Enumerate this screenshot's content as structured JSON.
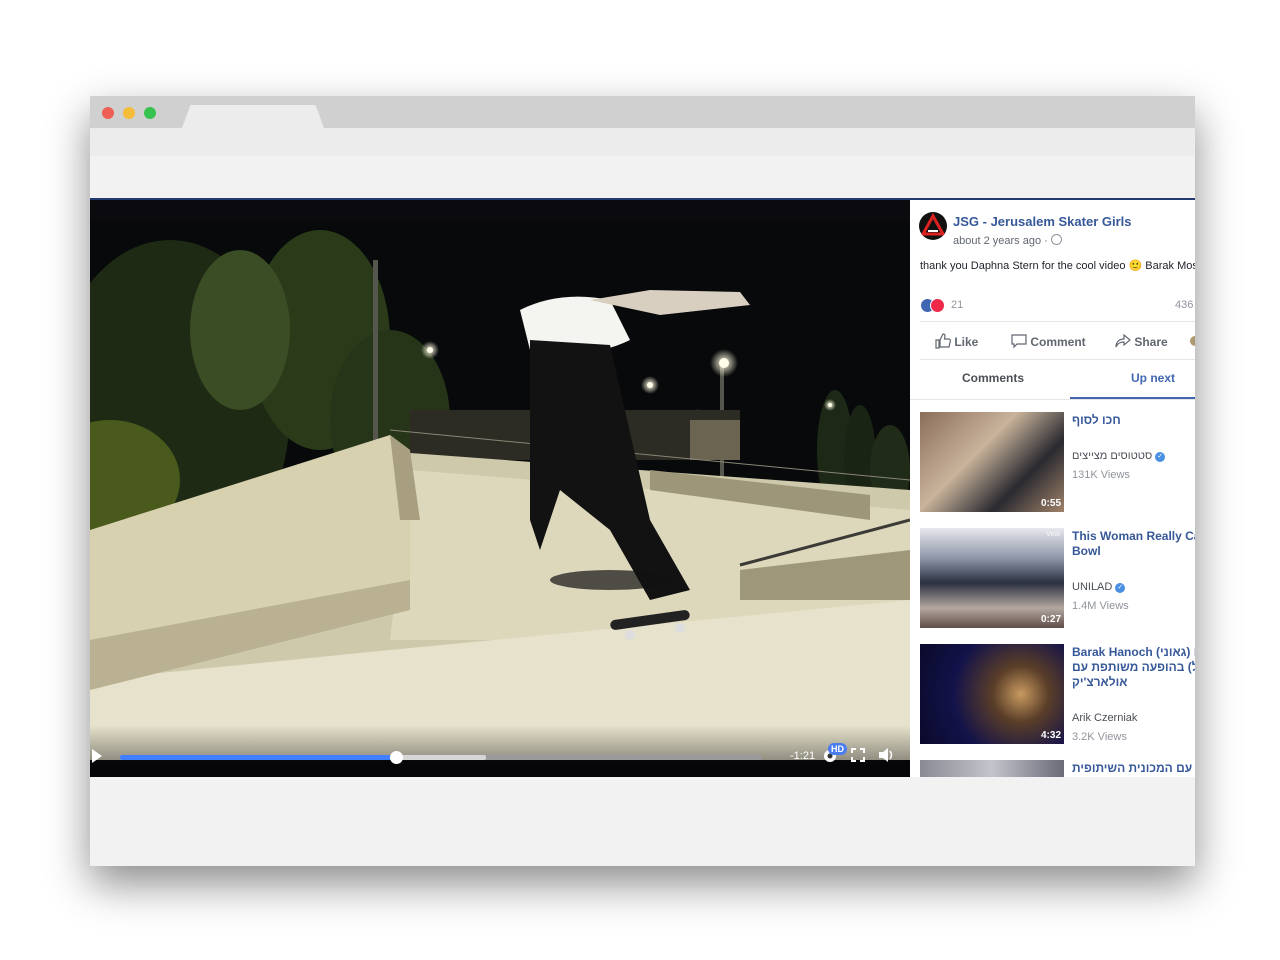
{
  "post": {
    "page_name": "JSG - Jerusalem Skater Girls",
    "time": "about 2 years ago · ",
    "text": "thank you Daphna Stern for the cool video 🙂 Barak Moses",
    "reactions_count": "21",
    "views_count": "436"
  },
  "actions": {
    "like": "Like",
    "comment": "Comment",
    "share": "Share"
  },
  "tabs": {
    "comments": "Comments",
    "up_next": "Up next"
  },
  "player": {
    "time_remaining": "-1:21",
    "hd_label": "HD",
    "progress_played": 0.43,
    "progress_buffered": 0.57
  },
  "up_next": [
    {
      "title_lines": [
        "חכו לסוף"
      ],
      "channel": "סטטוסים מצייצים",
      "views": "131K Views",
      "duration": "0:55"
    },
    {
      "title_lines": [
        "This Woman Really Ca",
        "Bowl"
      ],
      "channel": "UNILAD",
      "views": "1.4M Views",
      "duration": "0:27"
    },
    {
      "title_lines": [
        "Barak Hanoch (גאוני) ולו",
        "גיל) בהופעה משותפת עם",
        "אולארצ'יק"
      ],
      "channel": "Arik Czerniak",
      "views": "3.2K Views",
      "duration": "4:32"
    },
    {
      "title_lines": [
        "ניה עם המכונית השיתופית"
      ]
    }
  ],
  "colors": {
    "link": "#365899",
    "accent": "#4267b2",
    "progress": "#4080ff"
  }
}
